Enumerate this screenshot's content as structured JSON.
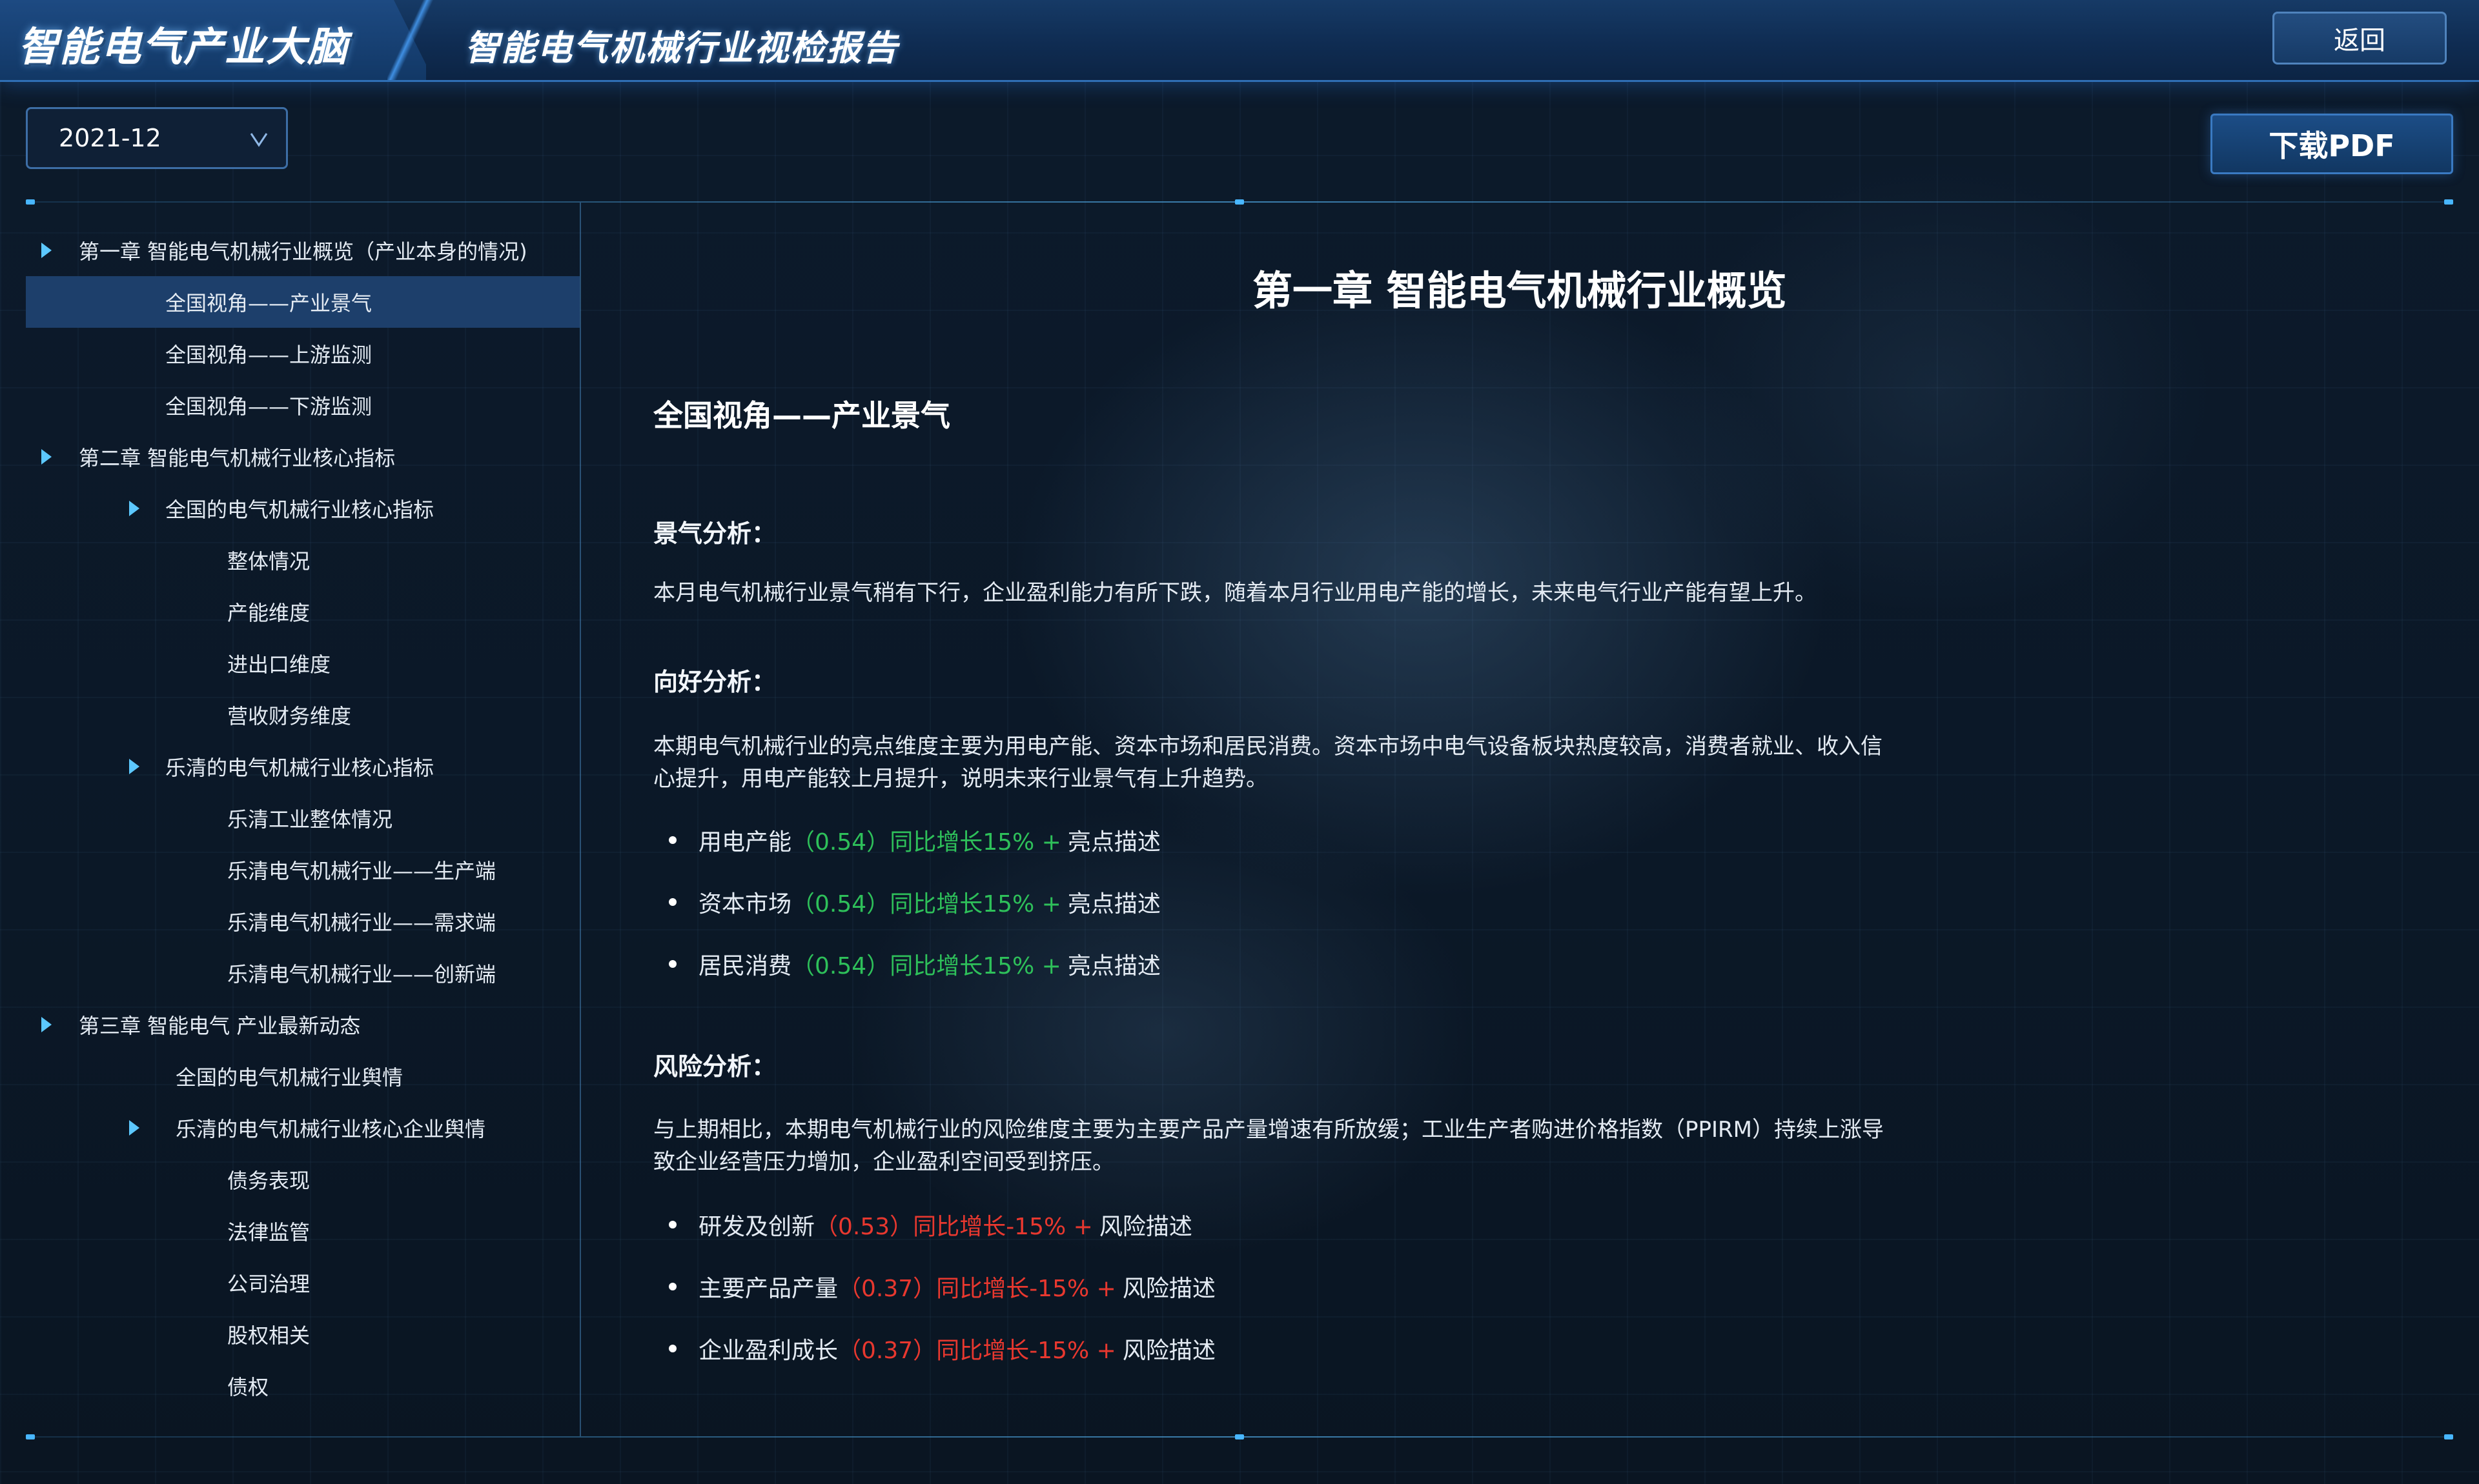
{
  "header": {
    "brand": "智能电气产业大脑",
    "report_title": "智能电气机械行业视检报告",
    "back_label": "返回"
  },
  "toolbar": {
    "date_value": "2021-12",
    "download_label": "下载PDF"
  },
  "sidebar": {
    "items": [
      {
        "label": "第一章 智能电气机械行业概览（产业本身的情况)",
        "level": 0,
        "arrow": true
      },
      {
        "label": "全国视角——产业景气",
        "level": 1,
        "arrow": false,
        "active": true
      },
      {
        "label": "全国视角——上游监测",
        "level": 1,
        "arrow": false
      },
      {
        "label": "全国视角——下游监测",
        "level": 1,
        "arrow": false
      },
      {
        "label": "第二章 智能电气机械行业核心指标",
        "level": 0,
        "arrow": true
      },
      {
        "label": "全国的电气机械行业核心指标",
        "level": 1,
        "arrow": true
      },
      {
        "label": "整体情况",
        "level": 2,
        "arrow": false
      },
      {
        "label": "产能维度",
        "level": 2,
        "arrow": false
      },
      {
        "label": "进出口维度",
        "level": 2,
        "arrow": false
      },
      {
        "label": "营收财务维度",
        "level": 2,
        "arrow": false
      },
      {
        "label": "乐清的电气机械行业核心指标",
        "level": 1,
        "arrow": true
      },
      {
        "label": "乐清工业整体情况",
        "level": 2,
        "arrow": false
      },
      {
        "label": "乐清电气机械行业——生产端",
        "level": 2,
        "arrow": false
      },
      {
        "label": "乐清电气机械行业——需求端",
        "level": 2,
        "arrow": false
      },
      {
        "label": "乐清电气机械行业——创新端",
        "level": 2,
        "arrow": false
      },
      {
        "label": "第三章 智能电气 产业最新动态",
        "level": 0,
        "arrow": true
      },
      {
        "label": "全国的电气机械行业舆情",
        "level": 1.2,
        "arrow": false
      },
      {
        "label": "乐清的电气机械行业核心企业舆情",
        "level": 1.2,
        "arrow": true
      },
      {
        "label": "债务表现",
        "level": 2,
        "arrow": false
      },
      {
        "label": "法律监管",
        "level": 2,
        "arrow": false
      },
      {
        "label": "公司治理",
        "level": 2,
        "arrow": false
      },
      {
        "label": "股权相关",
        "level": 2,
        "arrow": false
      },
      {
        "label": "债权",
        "level": 2,
        "arrow": false
      }
    ]
  },
  "content": {
    "chapter_title": "第一章 智能电气机械行业概览",
    "section_title": "全国视角——产业景气",
    "boom": {
      "heading": "景气分析：",
      "text": "本月电气机械行业景气稍有下行，企业盈利能力有所下跌，随着本月行业用电产能的增长，未来电气行业产能有望上升。"
    },
    "positive": {
      "heading": "向好分析：",
      "text_line1": "本期电气机械行业的亮点维度主要为用电产能、资本市场和居民消费。资本市场中电气设备板块热度较高，消费者就业、收入信",
      "text_line2": "心提升，用电产能较上月提升，说明未来行业景气有上升趋势。",
      "items": [
        {
          "name": "用电产能",
          "score": "（0.54）",
          "change": "同比增长15% +",
          "desc": "亮点描述"
        },
        {
          "name": "资本市场",
          "score": "（0.54）",
          "change": "同比增长15% +",
          "desc": "亮点描述"
        },
        {
          "name": "居民消费",
          "score": "（0.54）",
          "change": "同比增长15% +",
          "desc": "亮点描述"
        }
      ]
    },
    "risk": {
      "heading": "风险分析：",
      "text_line1": "与上期相比，本期电气机械行业的风险维度主要为主要产品产量增速有所放缓；工业生产者购进价格指数（PPIRM）持续上涨导",
      "text_line2": "致企业经营压力增加，企业盈利空间受到挤压。",
      "items": [
        {
          "name": "研发及创新",
          "score": "（0.53）",
          "change": "同比增长-15% +",
          "desc": "风险描述"
        },
        {
          "name": "主要产品产量",
          "score": "（0.37）",
          "change": "同比增长-15% +",
          "desc": "风险描述"
        },
        {
          "name": "企业盈利成长",
          "score": "（0.37）",
          "change": "同比增长-15% +",
          "desc": "风险描述"
        }
      ]
    }
  },
  "colors": {
    "positive": "#2ec05a",
    "risk": "#e8382f",
    "accent": "#48b6ff",
    "active_row": "#1d3f6b"
  }
}
